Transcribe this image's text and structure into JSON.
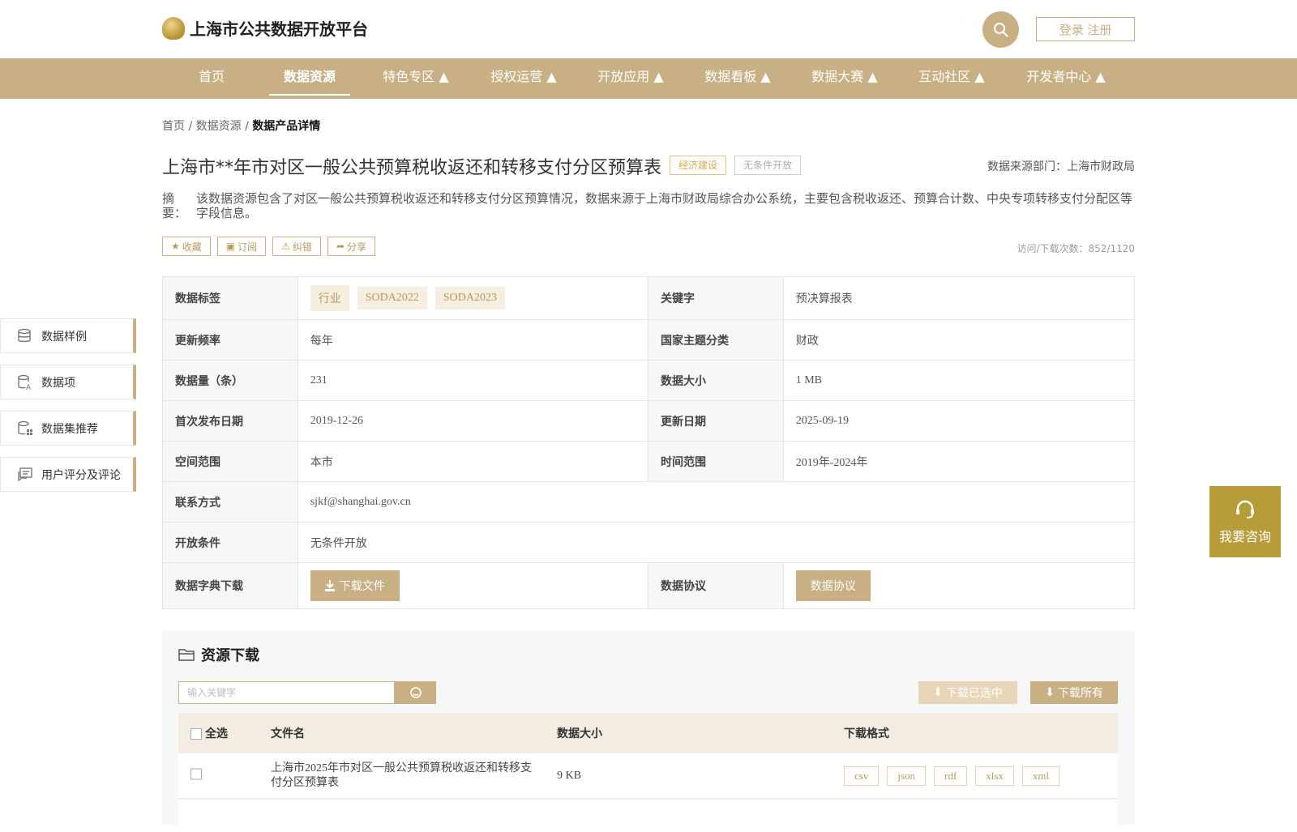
{
  "header": {
    "site_title": "上海市公共数据开放平台",
    "login_label": "登录 注册"
  },
  "nav": {
    "items": [
      {
        "label": "首页"
      },
      {
        "label": "数据资源"
      },
      {
        "label": "特色专区 ▲"
      },
      {
        "label": "授权运营 ▲"
      },
      {
        "label": "开放应用 ▲"
      },
      {
        "label": "数据看板 ▲"
      },
      {
        "label": "数据大赛 ▲"
      },
      {
        "label": "互动社区 ▲"
      },
      {
        "label": "开发者中心 ▲"
      }
    ],
    "active_index": 1
  },
  "breadcrumb": {
    "home": "首页",
    "sep": " / ",
    "resource": "数据资源",
    "current": "数据产品详情"
  },
  "dataset": {
    "title": "上海市**年市对区一般公共预算税收返还和转移支付分区预算表",
    "tag_econ": "经济建设",
    "tag_open": "无条件开放",
    "source": "数据来源部门：上海市财政局",
    "summary_label": "摘　要：",
    "summary": "该数据资源包含了对区一般公共预算税收返还和转移支付分区预算情况，数据来源于上海市财政局综合办公系统，主要包含税收返还、预算合计数、中央专项转移支付分配区等字段信息。",
    "visits": "访问/下载次数：852/1120"
  },
  "actions": {
    "collect": "收藏",
    "subscribe": "订阅",
    "correct": "纠错",
    "share": "分享"
  },
  "info": {
    "tags_label": "数据标签",
    "tags": [
      "行业",
      "SODA2022",
      "SODA2023"
    ],
    "keyword_label": "关键字",
    "keyword": "预决算报表",
    "freq_label": "更新频率",
    "freq": "每年",
    "theme_label": "国家主题分类",
    "theme": "财政",
    "count_label": "数据量（条）",
    "count": "231",
    "size_label": "数据大小",
    "size": "1 MB",
    "first_label": "首次发布日期",
    "first": "2019-12-26",
    "update_label": "更新日期",
    "update": "2025-09-19",
    "space_label": "空间范围",
    "space": "本市",
    "time_label": "时间范围",
    "time": "2019年-2024年",
    "contact_label": "联系方式",
    "contact": "sjkf@shanghai.gov.cn",
    "cond_label": "开放条件",
    "cond": "无条件开放",
    "dict_label": "数据字典下载",
    "dict_btn": "下载文件",
    "protocol_label": "数据协议",
    "protocol_btn": "数据协议"
  },
  "side": {
    "items": [
      "数据样例",
      "数据项",
      "数据集推荐",
      "用户评分及评论"
    ]
  },
  "consult": {
    "label": "我要咨询"
  },
  "resources": {
    "title": "资源下载",
    "search_placeholder": "输入关键字",
    "download_selected": "下载已选中",
    "download_all": "下载所有",
    "col_select_all": "全选",
    "col_name": "文件名",
    "col_size": "数据大小",
    "col_format": "下载格式",
    "rows": [
      {
        "name": "上海市2025年市对区一般公共预算税收返还和转移支付分区预算表",
        "size": "9 KB",
        "formats": [
          "csv",
          "json",
          "rdf",
          "xlsx",
          "xml"
        ]
      }
    ]
  }
}
